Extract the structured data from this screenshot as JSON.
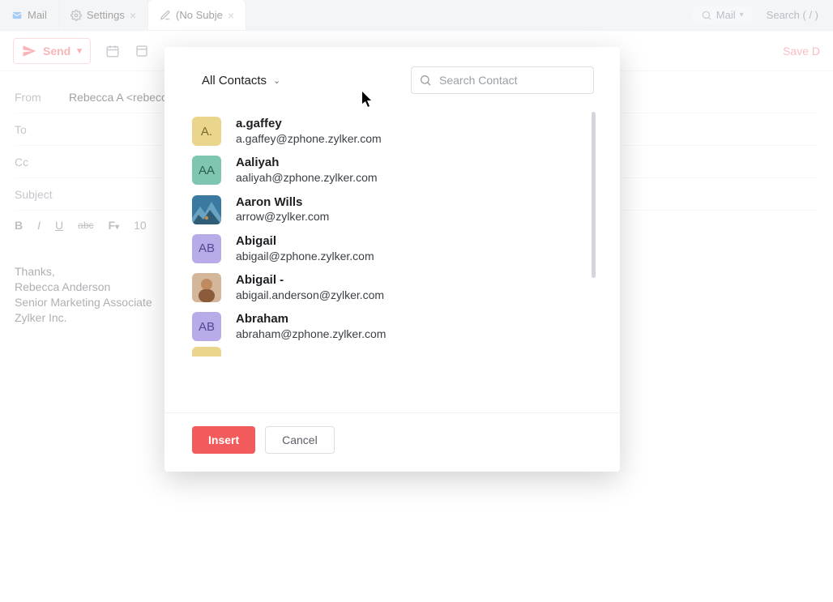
{
  "tabs": [
    {
      "label": "Mail",
      "active": false,
      "closable": false,
      "icon": "mail"
    },
    {
      "label": "Settings",
      "active": false,
      "closable": true,
      "icon": "gear"
    },
    {
      "label": "(No Subje",
      "active": true,
      "closable": true,
      "icon": "edit"
    }
  ],
  "top_right": {
    "mail_label": "Mail",
    "search_label": "Search",
    "search_shortcut": "( / )"
  },
  "toolbar": {
    "send_label": "Send",
    "save_draft_label": "Save D"
  },
  "compose": {
    "from_label": "From",
    "from_value": "Rebecca A <rebecca@",
    "to_label": "To",
    "cc_label": "Cc",
    "subject_label": "Subject"
  },
  "format": {
    "bold": "B",
    "italic": "I",
    "underline": "U",
    "strike": "abc",
    "font_label": "F",
    "size": "10"
  },
  "body": {
    "line1": "Thanks,",
    "line2": "Rebecca Anderson",
    "line3": "Senior Marketing Associate",
    "line4": "Zylker Inc."
  },
  "dialog": {
    "dropdown_label": "All Contacts",
    "search_placeholder": "Search Contact",
    "insert_label": "Insert",
    "cancel_label": "Cancel"
  },
  "contacts": [
    {
      "name": "a.gaffey",
      "email": "a.gaffey@zphone.zylker.com",
      "initials": "A.",
      "color": "#ead58c",
      "fg": "#7a6a2a",
      "photo": false
    },
    {
      "name": "Aaliyah",
      "email": "aaliyah@zphone.zylker.com",
      "initials": "AA",
      "color": "#7fc6b2",
      "fg": "#2d5e52",
      "photo": false
    },
    {
      "name": "Aaron Wills",
      "email": "arrow@zylker.com",
      "initials": "",
      "color": "#4a8aa8",
      "fg": "#fff",
      "photo": true,
      "photo_id": "mountain"
    },
    {
      "name": "Abigail",
      "email": "abigail@zphone.zylker.com",
      "initials": "AB",
      "color": "#b9abe8",
      "fg": "#534794",
      "photo": false
    },
    {
      "name": "Abigail -",
      "email": "abigail.anderson@zylker.com",
      "initials": "",
      "color": "#cfa98f",
      "fg": "#fff",
      "photo": true,
      "photo_id": "person"
    },
    {
      "name": "Abraham",
      "email": "abraham@zphone.zylker.com",
      "initials": "AB",
      "color": "#b9abe8",
      "fg": "#534794",
      "photo": false
    }
  ]
}
